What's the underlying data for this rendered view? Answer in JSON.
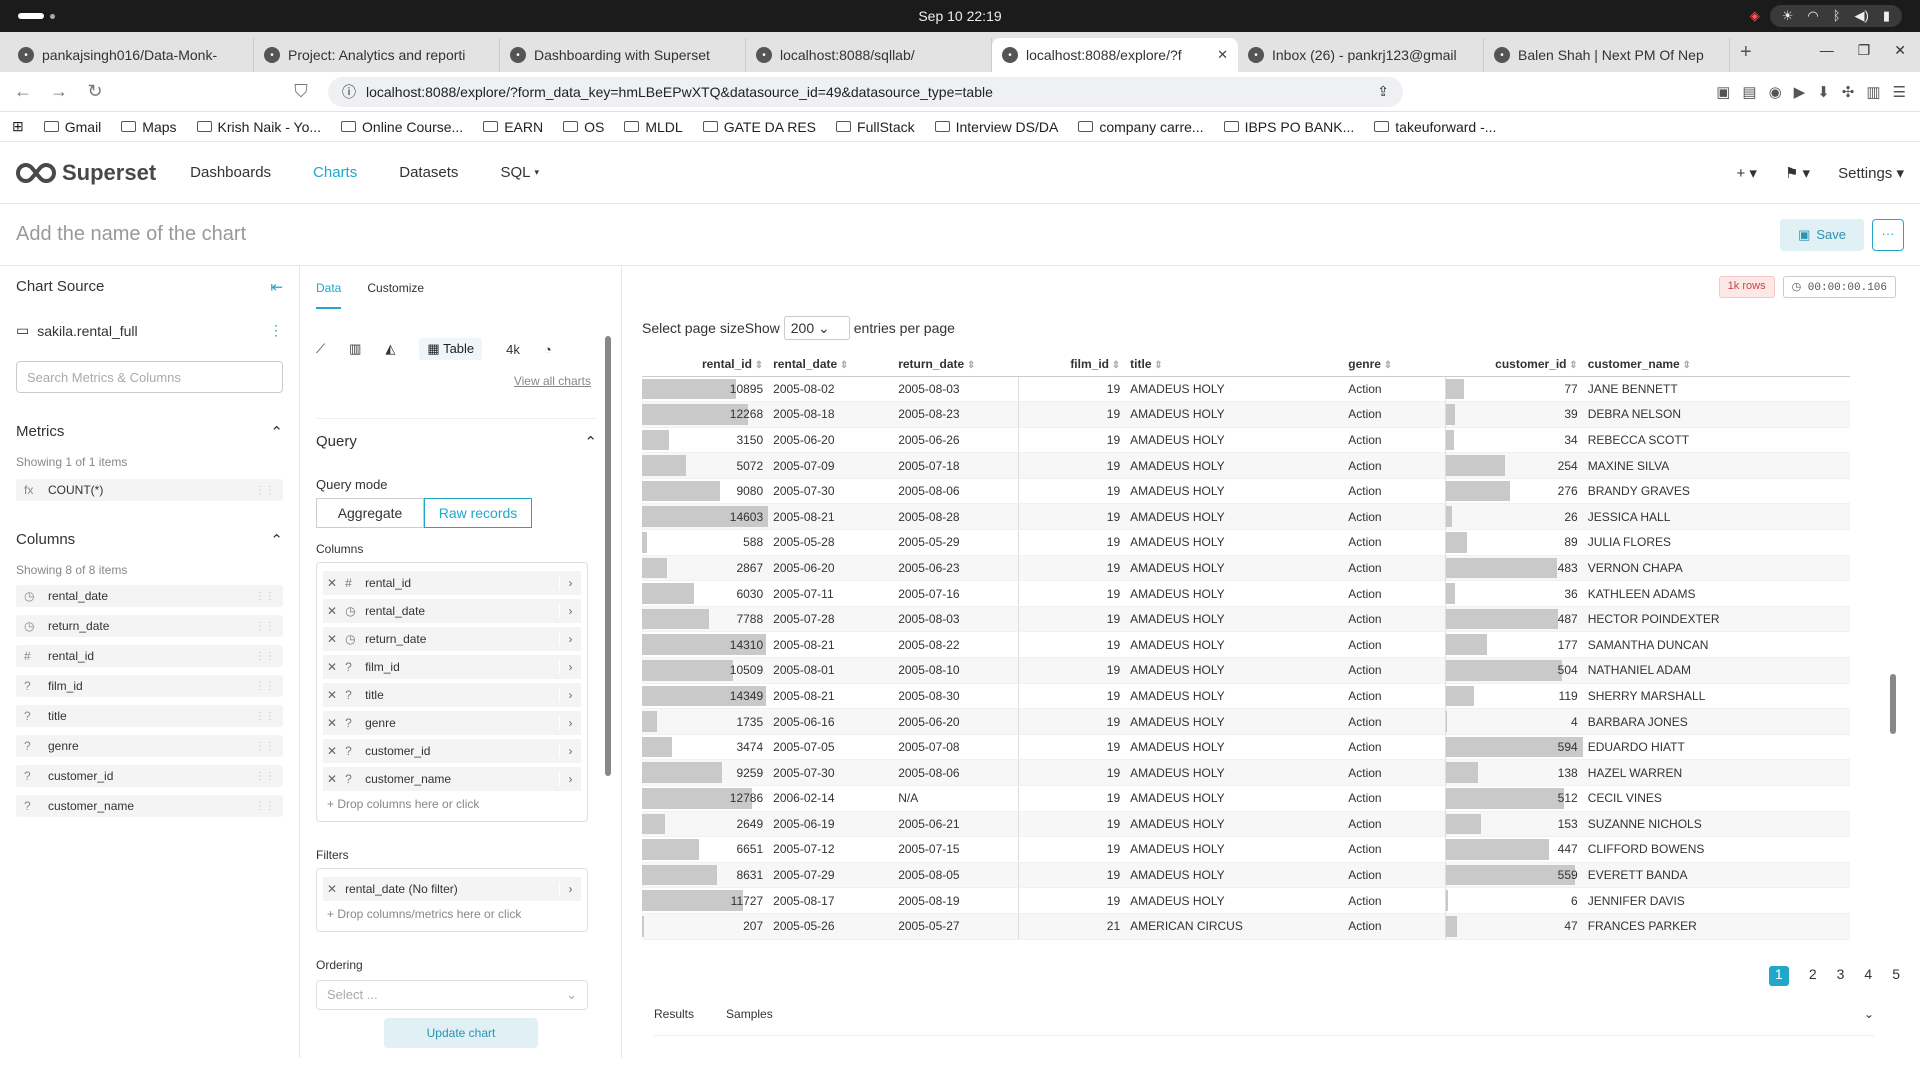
{
  "os": {
    "clock": "Sep 10  22:19"
  },
  "browser": {
    "tabs": [
      {
        "label": "pankajsingh016/Data-Monk-",
        "icon": "github-icon"
      },
      {
        "label": "Project: Analytics and reporti",
        "icon": "doc-icon"
      },
      {
        "label": "Dashboarding with Superset",
        "icon": "globe-icon"
      },
      {
        "label": "localhost:8088/sqllab/",
        "icon": "superset-icon"
      },
      {
        "label": "localhost:8088/explore/?f",
        "icon": "superset-icon",
        "active": true
      },
      {
        "label": "Inbox (26) - pankrj123@gmail",
        "icon": "gmail-icon"
      },
      {
        "label": "Balen Shah | Next PM Of Nep",
        "icon": "youtube-icon"
      }
    ],
    "url": "localhost:8088/explore/?form_data_key=hmLBeEPwXTQ&datasource_id=49&datasource_type=table",
    "bookmarks": [
      "Gmail",
      "Maps",
      "Krish Naik - Yo...",
      "Online Course...",
      "EARN",
      "OS",
      "MLDL",
      "GATE DA RES",
      "FullStack",
      "Interview DS/DA",
      "company carre...",
      "IBPS PO BANK...",
      "takeuforward -..."
    ]
  },
  "nav": {
    "brand": "Superset",
    "items": [
      "Dashboards",
      "Charts",
      "Datasets",
      "SQL"
    ],
    "settings": "Settings"
  },
  "header": {
    "chart_name_placeholder": "Add the name of the chart",
    "save": "Save"
  },
  "datasource": {
    "title": "Chart Source",
    "name": "sakila.rental_full",
    "search_placeholder": "Search Metrics & Columns",
    "metrics_title": "Metrics",
    "metrics_count": "Showing 1 of 1 items",
    "metrics": [
      {
        "type": "fx",
        "name": "COUNT(*)"
      }
    ],
    "columns_title": "Columns",
    "columns_count": "Showing 8 of 8 items",
    "columns": [
      {
        "type": "◷",
        "name": "rental_date"
      },
      {
        "type": "◷",
        "name": "return_date"
      },
      {
        "type": "#",
        "name": "rental_id"
      },
      {
        "type": "?",
        "name": "film_id"
      },
      {
        "type": "?",
        "name": "title"
      },
      {
        "type": "?",
        "name": "genre"
      },
      {
        "type": "?",
        "name": "customer_id"
      },
      {
        "type": "?",
        "name": "customer_name"
      }
    ]
  },
  "control": {
    "tab_data": "Data",
    "tab_customize": "Customize",
    "viz_table": "Table",
    "viz_4k": "4k",
    "view_all": "View all charts",
    "query": "Query",
    "query_mode": "Query mode",
    "mode_aggregate": "Aggregate",
    "mode_raw": "Raw records",
    "columns_label": "Columns",
    "columns": [
      {
        "type": "#",
        "name": "rental_id"
      },
      {
        "type": "◷",
        "name": "rental_date"
      },
      {
        "type": "◷",
        "name": "return_date"
      },
      {
        "type": "?",
        "name": "film_id"
      },
      {
        "type": "?",
        "name": "title"
      },
      {
        "type": "?",
        "name": "genre"
      },
      {
        "type": "?",
        "name": "customer_id"
      },
      {
        "type": "?",
        "name": "customer_name"
      }
    ],
    "drop_columns": "Drop columns here or click",
    "filters_label": "Filters",
    "filter": "rental_date (No filter)",
    "drop_filters": "Drop columns/metrics here or click",
    "ordering_label": "Ordering",
    "ordering_placeholder": "Select ...",
    "update": "Update chart"
  },
  "viz": {
    "rows_badge": "1k rows",
    "timer": "00:00:00.106",
    "page_size_label": "Select page sizeShow",
    "page_size": "200",
    "page_size_suffix": "entries per page",
    "pages": [
      "1",
      "2",
      "3",
      "4",
      "5"
    ],
    "bottom_tabs": [
      "Results",
      "Samples"
    ]
  },
  "chart_data": {
    "type": "table",
    "columns": [
      "rental_id",
      "rental_date",
      "return_date",
      "film_id",
      "title",
      "genre",
      "customer_id",
      "customer_name"
    ],
    "rows": [
      [
        10895,
        "2005-08-02",
        "2005-08-03",
        19,
        "AMADEUS HOLY",
        "Action",
        77,
        "JANE BENNETT"
      ],
      [
        12268,
        "2005-08-18",
        "2005-08-23",
        19,
        "AMADEUS HOLY",
        "Action",
        39,
        "DEBRA NELSON"
      ],
      [
        3150,
        "2005-06-20",
        "2005-06-26",
        19,
        "AMADEUS HOLY",
        "Action",
        34,
        "REBECCA SCOTT"
      ],
      [
        5072,
        "2005-07-09",
        "2005-07-18",
        19,
        "AMADEUS HOLY",
        "Action",
        254,
        "MAXINE SILVA"
      ],
      [
        9080,
        "2005-07-30",
        "2005-08-06",
        19,
        "AMADEUS HOLY",
        "Action",
        276,
        "BRANDY GRAVES"
      ],
      [
        14603,
        "2005-08-21",
        "2005-08-28",
        19,
        "AMADEUS HOLY",
        "Action",
        26,
        "JESSICA HALL"
      ],
      [
        588,
        "2005-05-28",
        "2005-05-29",
        19,
        "AMADEUS HOLY",
        "Action",
        89,
        "JULIA FLORES"
      ],
      [
        2867,
        "2005-06-20",
        "2005-06-23",
        19,
        "AMADEUS HOLY",
        "Action",
        483,
        "VERNON CHAPA"
      ],
      [
        6030,
        "2005-07-11",
        "2005-07-16",
        19,
        "AMADEUS HOLY",
        "Action",
        36,
        "KATHLEEN ADAMS"
      ],
      [
        7788,
        "2005-07-28",
        "2005-08-03",
        19,
        "AMADEUS HOLY",
        "Action",
        487,
        "HECTOR POINDEXTER"
      ],
      [
        14310,
        "2005-08-21",
        "2005-08-22",
        19,
        "AMADEUS HOLY",
        "Action",
        177,
        "SAMANTHA DUNCAN"
      ],
      [
        10509,
        "2005-08-01",
        "2005-08-10",
        19,
        "AMADEUS HOLY",
        "Action",
        504,
        "NATHANIEL ADAM"
      ],
      [
        14349,
        "2005-08-21",
        "2005-08-30",
        19,
        "AMADEUS HOLY",
        "Action",
        119,
        "SHERRY MARSHALL"
      ],
      [
        1735,
        "2005-06-16",
        "2005-06-20",
        19,
        "AMADEUS HOLY",
        "Action",
        4,
        "BARBARA JONES"
      ],
      [
        3474,
        "2005-07-05",
        "2005-07-08",
        19,
        "AMADEUS HOLY",
        "Action",
        594,
        "EDUARDO HIATT"
      ],
      [
        9259,
        "2005-07-30",
        "2005-08-06",
        19,
        "AMADEUS HOLY",
        "Action",
        138,
        "HAZEL WARREN"
      ],
      [
        12786,
        "2006-02-14",
        "N/A",
        19,
        "AMADEUS HOLY",
        "Action",
        512,
        "CECIL VINES"
      ],
      [
        2649,
        "2005-06-19",
        "2005-06-21",
        19,
        "AMADEUS HOLY",
        "Action",
        153,
        "SUZANNE NICHOLS"
      ],
      [
        6651,
        "2005-07-12",
        "2005-07-15",
        19,
        "AMADEUS HOLY",
        "Action",
        447,
        "CLIFFORD BOWENS"
      ],
      [
        8631,
        "2005-07-29",
        "2005-08-05",
        19,
        "AMADEUS HOLY",
        "Action",
        559,
        "EVERETT BANDA"
      ],
      [
        11727,
        "2005-08-17",
        "2005-08-19",
        19,
        "AMADEUS HOLY",
        "Action",
        6,
        "JENNIFER DAVIS"
      ],
      [
        207,
        "2005-05-26",
        "2005-05-27",
        21,
        "AMERICAN CIRCUS",
        "Action",
        47,
        "FRANCES PARKER"
      ]
    ]
  }
}
